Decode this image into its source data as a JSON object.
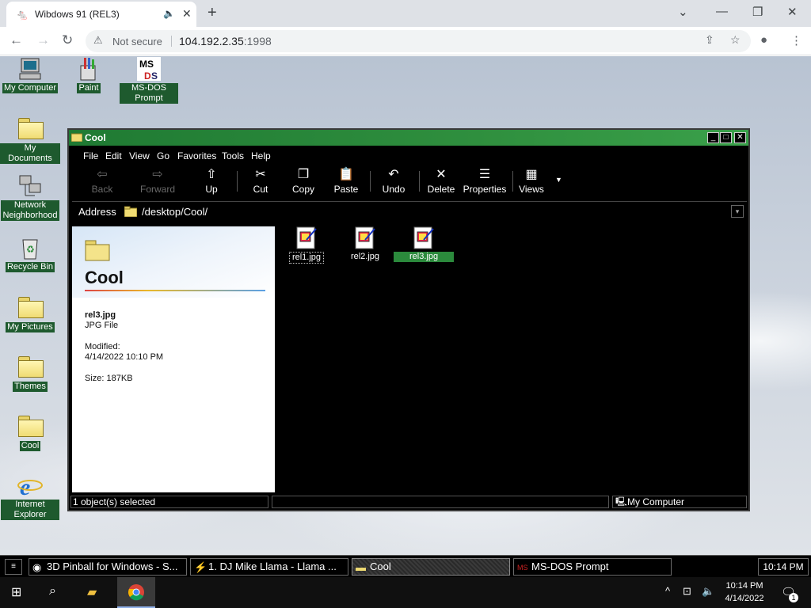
{
  "browser": {
    "tab_title": "Wibdows 91 (REL3)",
    "security_label": "Not secure",
    "url_host": "104.192.2.35",
    "url_port": ":1998"
  },
  "desktop": {
    "icons": [
      {
        "label": "My Computer"
      },
      {
        "label": "Paint"
      },
      {
        "label": "MS-DOS Prompt"
      },
      {
        "label": "My Documents"
      },
      {
        "label": "Network Neighborhood"
      },
      {
        "label": "Recycle Bin"
      },
      {
        "label": "My Pictures"
      },
      {
        "label": "Themes"
      },
      {
        "label": "Cool"
      },
      {
        "label": "Internet Explorer"
      }
    ]
  },
  "explorer": {
    "title": "Cool",
    "menu": [
      "File",
      "Edit",
      "View",
      "Go",
      "Favorites",
      "Tools",
      "Help"
    ],
    "toolbar": {
      "back": "Back",
      "forward": "Forward",
      "up": "Up",
      "cut": "Cut",
      "copy": "Copy",
      "paste": "Paste",
      "undo": "Undo",
      "delete": "Delete",
      "properties": "Properties",
      "views": "Views"
    },
    "address_label": "Address",
    "address_value": "/desktop/Cool/",
    "info": {
      "heading": "Cool",
      "file_name": "rel3.jpg",
      "file_type": "JPG File",
      "modified_label": "Modified:",
      "modified_value": "4/14/2022 10:10 PM",
      "size": "Size: 187KB"
    },
    "files": [
      "rel1.jpg",
      "rel2.jpg",
      "rel3.jpg"
    ],
    "selected_file": "rel3.jpg",
    "status_left": "1 object(s) selected",
    "status_right": "My Computer"
  },
  "taskbar98": {
    "items": [
      "3D Pinball for Windows - S...",
      "1. DJ Mike Llama - Llama ...",
      "Cool",
      "MS-DOS Prompt"
    ],
    "clock": "10:14 PM"
  },
  "taskbar10": {
    "time": "10:14 PM",
    "date": "4/14/2022",
    "notification_count": "1"
  }
}
